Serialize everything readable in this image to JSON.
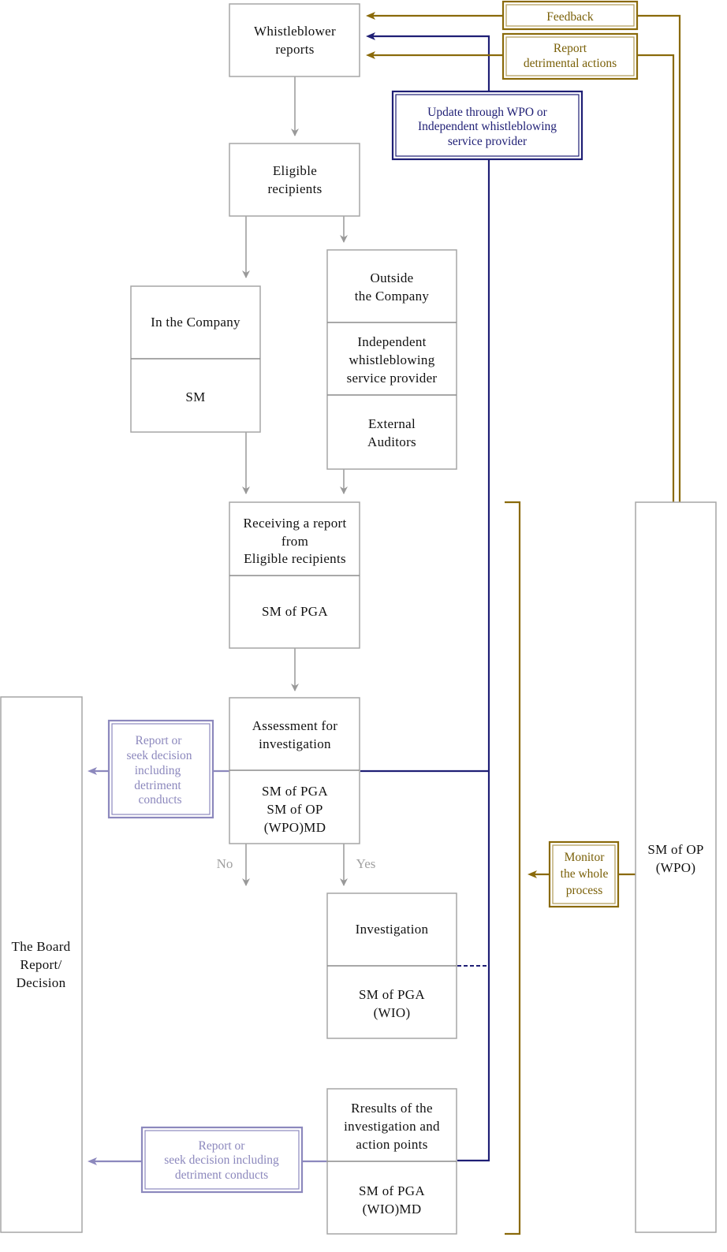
{
  "diagram": {
    "nodes": {
      "whistleblower": {
        "lines": [
          "Whistleblower",
          "reports"
        ]
      },
      "eligible": {
        "lines": [
          "Eligible",
          "recipients"
        ]
      },
      "in_company": {
        "top": [
          "In the Company"
        ],
        "bottom": [
          "SM"
        ]
      },
      "outside_company": {
        "top": [
          "Outside",
          "the Company"
        ],
        "middle": [
          "Independent",
          "whistleblowing",
          "service provider"
        ],
        "bottom": [
          "External",
          "Auditors"
        ]
      },
      "receiving": {
        "top": [
          "Receiving a report",
          "from",
          "Eligible recipients"
        ],
        "bottom": [
          "SM of PGA"
        ]
      },
      "assessment": {
        "top": [
          "Assessment for",
          "investigation"
        ],
        "bottom": [
          "SM of PGA",
          "SM of OP",
          "(WPO)MD"
        ]
      },
      "investigation": {
        "top": [
          "Investigation"
        ],
        "bottom": [
          "SM of PGA",
          "(WIO)"
        ]
      },
      "results": {
        "top": [
          "Rresults of the",
          "investigation and",
          "action points"
        ],
        "bottom": [
          "SM of PGA",
          "(WIO)MD"
        ]
      },
      "board": {
        "lines": [
          "The Board",
          "Report/",
          "Decision"
        ]
      },
      "wpo": {
        "lines": [
          "SM of OP",
          "(WPO)"
        ]
      }
    },
    "labels": {
      "feedback": [
        "Feedback"
      ],
      "report_detrimental": [
        "Report",
        "detrimental actions"
      ],
      "update": [
        "Update through WPO or",
        "Independent whistleblowing",
        "service provider"
      ],
      "report_seek_1": [
        "Report or",
        "seek decision",
        "including",
        "detriment",
        "conducts"
      ],
      "report_seek_2": [
        "Report or",
        "seek decision including",
        "detriment conducts"
      ],
      "monitor": [
        "Monitor",
        "the whole",
        "process"
      ],
      "no": "No",
      "yes": "Yes"
    },
    "colors": {
      "gold": "#8a6a0a",
      "navy": "#1f1f75",
      "lavender": "#8c88bd",
      "grey": "#999999"
    }
  }
}
